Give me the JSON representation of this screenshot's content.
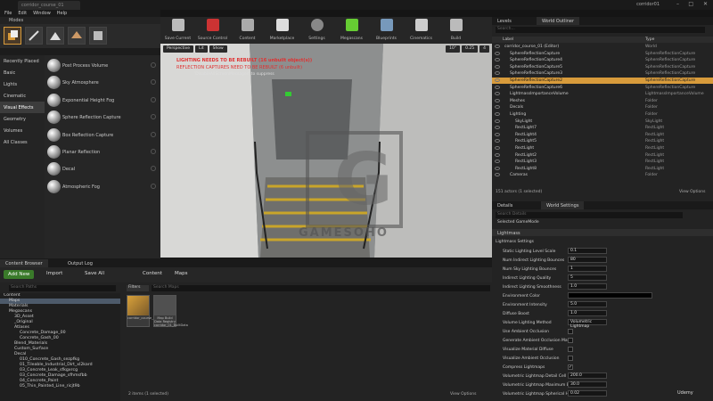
{
  "titlebar": {
    "tab": "corridor_course_01",
    "project": "corridor01"
  },
  "menu": [
    "File",
    "Edit",
    "Window",
    "Help"
  ],
  "modes": {
    "title": "Modes"
  },
  "categories": [
    "Recently Placed",
    "Basic",
    "Lights",
    "Cinematic",
    "Visual Effects",
    "Geometry",
    "Volumes",
    "All Classes"
  ],
  "placeables": [
    "Post Process Volume",
    "Sky Atmosphere",
    "Exponential Height Fog",
    "Sphere Reflection Capture",
    "Box Reflection Capture",
    "Planar Reflection",
    "Decal",
    "Atmospheric Fog"
  ],
  "toolbar": [
    "Save Current",
    "Source Control",
    "Content",
    "Marketplace",
    "Settings",
    "Megascans",
    "Blueprints",
    "Cinematics",
    "Build"
  ],
  "viewport": {
    "perspective": "Perspective",
    "lit": "Lit",
    "show": "Show",
    "msg1": "LIGHTING NEEDS TO BE REBUILT (16 unbuilt object(s))",
    "msg2": "REFLECTION CAPTURES NEED TO BE REBUILT (6 unbuilt)",
    "msg3": "'DisableAllScreenMessages' to suppress",
    "grid": "10°",
    "speed": "0.25",
    "cam": "4",
    "watermark": "GAMESOHO"
  },
  "content_browser": {
    "tabs": [
      "Content Browser",
      "Output Log"
    ],
    "add_new": "Add New",
    "import": "Import",
    "save_all": "Save All",
    "path": [
      "Content",
      "Maps"
    ],
    "search_paths": "Search Paths",
    "filters": "Filters",
    "search_maps": "Search Maps",
    "items_status": "2 items (1 selected)",
    "view_options": "View Options",
    "tree": [
      {
        "label": "Content",
        "indent": 0
      },
      {
        "label": "Maps",
        "indent": 1,
        "sel": true
      },
      {
        "label": "Materials",
        "indent": 1
      },
      {
        "label": "Megascans",
        "indent": 1
      },
      {
        "label": "3D_Asset",
        "indent": 2
      },
      {
        "label": "_Original",
        "indent": 2
      },
      {
        "label": "Atlases",
        "indent": 2
      },
      {
        "label": "Concrete_Damage_00",
        "indent": 3
      },
      {
        "label": "Concrete_Gash_00",
        "indent": 3
      },
      {
        "label": "Blend_Materials",
        "indent": 2
      },
      {
        "label": "Custom_Surface",
        "indent": 2
      },
      {
        "label": "Decal",
        "indent": 2
      },
      {
        "label": "010_Concrete_Gash_sezpfkg",
        "indent": 3
      },
      {
        "label": "01_Tileable_Industrial_Dirt_xl2kard",
        "indent": 3
      },
      {
        "label": "03_Concrete_Leak_sfkgxrcg",
        "indent": 3
      },
      {
        "label": "03_Concrete_Damage_sfhmsfbb",
        "indent": 3
      },
      {
        "label": "04_Concrete_Paint",
        "indent": 3
      },
      {
        "label": "05_Thin_Painted_Line_ricjt9b",
        "indent": 3
      }
    ],
    "assets": [
      "corridor_course_01",
      "Map Build Data Registry corridor_01_BuiltData"
    ]
  },
  "levels_tabs": [
    "Levels",
    "World Outliner"
  ],
  "outliner": {
    "search": "Search...",
    "col_label": "Label",
    "col_type": "Type",
    "rows": [
      {
        "n": "corridor_course_01 (Editor)",
        "t": "World",
        "i": 0
      },
      {
        "n": "SphereReflectionCapture",
        "t": "SphereReflectionCapture",
        "i": 1
      },
      {
        "n": "SphereReflectionCapture4",
        "t": "SphereReflectionCapture",
        "i": 1
      },
      {
        "n": "SphereReflectionCapture5",
        "t": "SphereReflectionCapture",
        "i": 1
      },
      {
        "n": "SphereReflectionCapture3",
        "t": "SphereReflectionCapture",
        "i": 1
      },
      {
        "n": "SphereReflectionCapture2",
        "t": "SphereReflectionCapture",
        "i": 1,
        "hl": true
      },
      {
        "n": "SphereReflectionCapture6",
        "t": "SphereReflectionCapture",
        "i": 1
      },
      {
        "n": "LightmassImportanceVolume",
        "t": "LightmassImportanceVolume",
        "i": 1
      },
      {
        "n": "Meshes",
        "t": "Folder",
        "i": 1
      },
      {
        "n": "Decals",
        "t": "Folder",
        "i": 1
      },
      {
        "n": "Lighting",
        "t": "Folder",
        "i": 1
      },
      {
        "n": "SkyLight",
        "t": "SkyLight",
        "i": 2
      },
      {
        "n": "RectLight7",
        "t": "RectLight",
        "i": 2
      },
      {
        "n": "RectLight4",
        "t": "RectLight",
        "i": 2
      },
      {
        "n": "RectLight5",
        "t": "RectLight",
        "i": 2
      },
      {
        "n": "RectLight",
        "t": "RectLight",
        "i": 2
      },
      {
        "n": "RectLight2",
        "t": "RectLight",
        "i": 2
      },
      {
        "n": "RectLight3",
        "t": "RectLight",
        "i": 2
      },
      {
        "n": "RectLight8",
        "t": "RectLight",
        "i": 2
      },
      {
        "n": "Cameras",
        "t": "Folder",
        "i": 1
      }
    ],
    "status": "151 actors (1 selected)",
    "view_options": "View Options"
  },
  "details_tabs": [
    "Details",
    "World Settings"
  ],
  "details": {
    "search": "Search Details",
    "selected_gm": "Selected GameMode",
    "section": "Lightmass",
    "subsection": "Lightmass Settings",
    "rows": [
      {
        "l": "Static Lighting Level Scale",
        "v": "0.1",
        "k": "num"
      },
      {
        "l": "Num Indirect Lighting Bounces",
        "v": "80",
        "k": "num"
      },
      {
        "l": "Num Sky Lighting Bounces",
        "v": "1",
        "k": "num"
      },
      {
        "l": "Indirect Lighting Quality",
        "v": "5",
        "k": "num"
      },
      {
        "l": "Indirect Lighting Smoothness",
        "v": "1.0",
        "k": "num"
      },
      {
        "l": "Environment Color",
        "v": "",
        "k": "color"
      },
      {
        "l": "Environment Intensity",
        "v": "5.0",
        "k": "num"
      },
      {
        "l": "Diffuse Boost",
        "v": "1.0",
        "k": "num"
      },
      {
        "l": "Volume Lighting Method",
        "v": "Volumetric Lightmap",
        "k": "drop"
      },
      {
        "l": "Use Ambient Occlusion",
        "v": "",
        "k": "chk"
      },
      {
        "l": "Generate Ambient Occlusion Mate",
        "v": "",
        "k": "chk"
      },
      {
        "l": "Visualize Material Diffuse",
        "v": "",
        "k": "chk"
      },
      {
        "l": "Visualize Ambient Occlusion",
        "v": "",
        "k": "chk"
      },
      {
        "l": "Compress Lightmaps",
        "v": "",
        "k": "chkon"
      },
      {
        "l": "Volumetric Lightmap Detail Cell Siz",
        "v": "200.0",
        "k": "num"
      },
      {
        "l": "Volumetric Lightmap Maximum Brick",
        "v": "30.0",
        "k": "num"
      },
      {
        "l": "Volumetric Lightmap Spherical Harm",
        "v": "0.02",
        "k": "num"
      }
    ]
  },
  "udemy": "Udemy"
}
